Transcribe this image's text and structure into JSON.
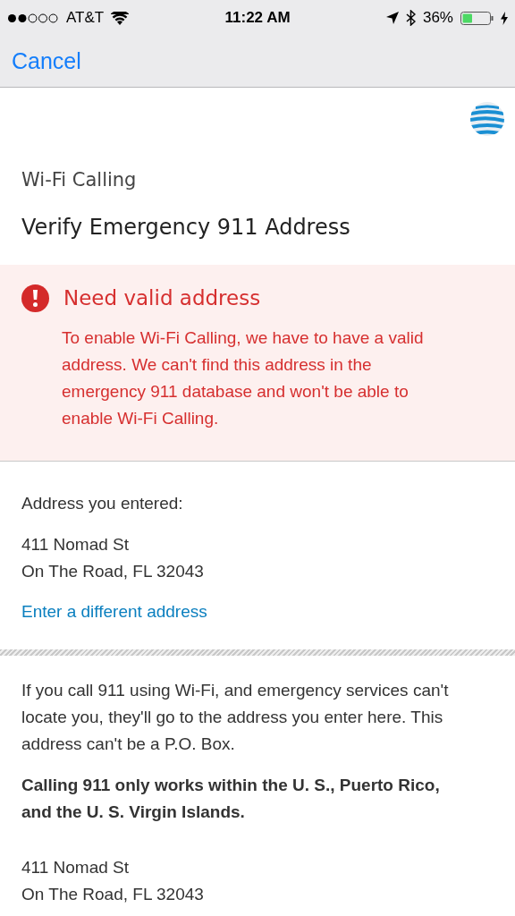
{
  "status_bar": {
    "carrier": "AT&T",
    "time": "11:22 AM",
    "battery": "36%"
  },
  "nav": {
    "cancel": "Cancel"
  },
  "header": {
    "eyebrow": "Wi-Fi Calling",
    "title": "Verify Emergency 911 Address"
  },
  "alert": {
    "title": "Need valid address",
    "message": "To enable Wi-Fi Calling, we have to have a valid address. We can't find this address in the emergency 911 database and won't be able to enable Wi-Fi Calling."
  },
  "entered": {
    "label": "Address you entered:",
    "lines": [
      "411 Nomad St",
      "On The Road, FL 32043"
    ],
    "link": "Enter a different address"
  },
  "info": {
    "paragraph": "If you call 911 using Wi-Fi, and emergency services can't locate you, they'll go to the address you enter here. This address can't be a P.O. Box.",
    "notice": "Calling 911 only works within the U. S., Puerto Rico, and the U. S. Virgin Islands.",
    "lines": [
      "411 Nomad St",
      "On The Road, FL 32043"
    ]
  }
}
